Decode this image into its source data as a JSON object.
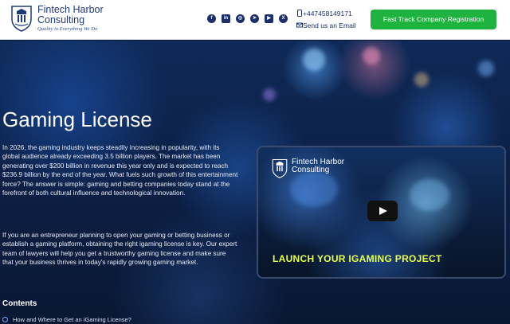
{
  "header": {
    "logo": {
      "name": "Fintech Harbor Consulting",
      "tagline": "Quality in Everything We Do"
    },
    "socials": [
      {
        "icon": "facebook-icon",
        "glyph": "f"
      },
      {
        "icon": "linkedin-icon",
        "glyph": "in"
      },
      {
        "icon": "instagram-icon",
        "glyph": "◎"
      },
      {
        "icon": "telegram-icon",
        "glyph": "➤"
      },
      {
        "icon": "youtube-icon",
        "glyph": "▶"
      },
      {
        "icon": "x-icon",
        "glyph": "X"
      }
    ],
    "phone": "+447458149171",
    "email_label": "Send us an Email",
    "cta_label": "Fast Track Company Registration"
  },
  "hero": {
    "title": "Gaming License",
    "paragraph1": "In 2026, the gaming industry keeps steadily increasing in popularity, with its global audience already exceeding 3.5 billion players. The market has been generating over $200 billion in revenue this year only and is expected to reach $236.9 billion by the end of the year. What fuels such growth of this entertainment force? The answer is simple: gaming and betting companies today stand at the forefront of both cultural influence and technological innovation.",
    "paragraph2": "If you are an entrepreneur planning to open your gaming or betting business or establish a gaming platform, obtaining the right igaming license is key. Our expert team of lawyers will help you get a trustworthy gaming license and make sure that your business thrives in today's rapidly growing gaming market.",
    "contents_heading": "Contents",
    "toc": [
      "How and Where to Get an iGaming License?"
    ]
  },
  "video": {
    "logo_name": "Fintech Harbor Consulting",
    "caption": "LAUNCH YOUR IGAMING PROJECT"
  },
  "colors": {
    "brand_blue": "#1d2f6b",
    "cta_green": "#1eb23f",
    "caption_yellow": "#e9ff4a"
  }
}
